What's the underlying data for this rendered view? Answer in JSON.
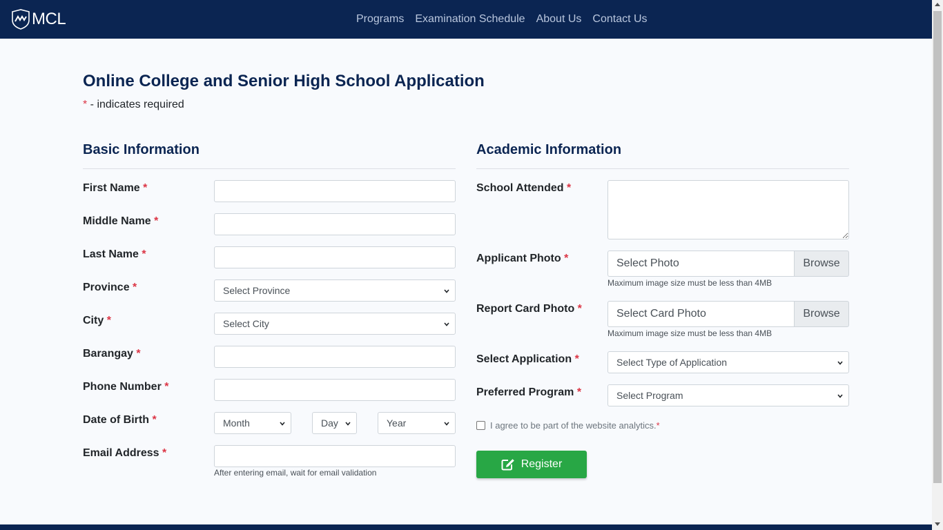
{
  "brand": {
    "name": "MCL"
  },
  "nav": {
    "items": [
      "Programs",
      "Examination Schedule",
      "About Us",
      "Contact Us"
    ]
  },
  "page": {
    "title": "Online College and Senior High School Application",
    "required_star": "*",
    "required_note": " - indicates required"
  },
  "basic": {
    "title": "Basic Information",
    "first_name": "First Name",
    "middle_name": "Middle Name",
    "last_name": "Last Name",
    "province": "Province",
    "province_value": "Select Province",
    "city": "City",
    "city_value": "Select City",
    "barangay": "Barangay",
    "phone": "Phone Number",
    "dob": "Date of Birth",
    "dob_month": "Month",
    "dob_day": "Day",
    "dob_year": "Year",
    "email": "Email Address",
    "email_help": "After entering email, wait for email validation"
  },
  "academic": {
    "title": "Academic Information",
    "school": "School Attended",
    "photo": "Applicant Photo",
    "photo_placeholder": "Select Photo",
    "browse": "Browse",
    "photo_help": "Maximum image size must be less than 4MB",
    "card": "Report Card Photo",
    "card_placeholder": "Select Card Photo",
    "card_help": "Maximum image size must be less than 4MB",
    "application": "Select Application",
    "application_value": "Select Type of Application",
    "program": "Preferred Program",
    "program_value": "Select Program",
    "agree": "I agree to be part of the website analytics.",
    "register": "Register"
  },
  "colors": {
    "navbar": "#0b2552",
    "heading": "#0b2552",
    "required": "#dc3545",
    "register": "#28a745"
  }
}
